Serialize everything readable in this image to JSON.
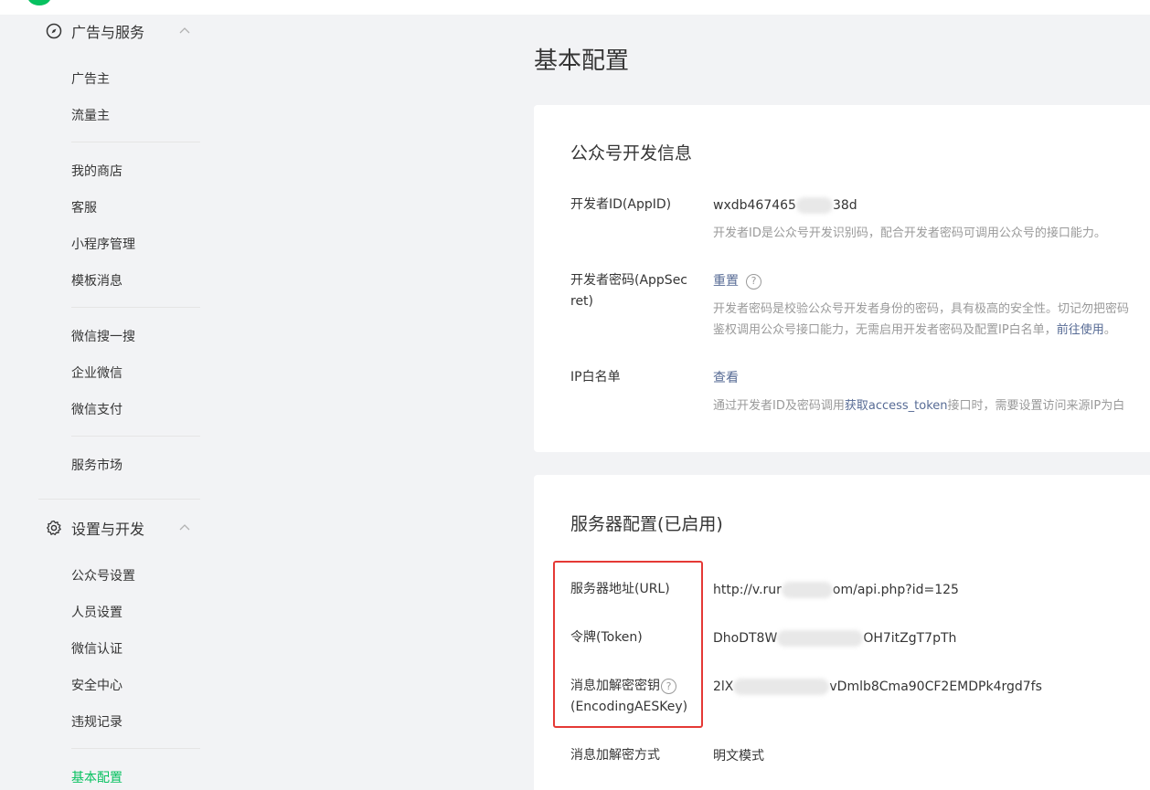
{
  "sidebar": {
    "ads_section": {
      "title": "广告与服务",
      "icon": "compass-icon"
    },
    "ads_items": [
      "广告主",
      "流量主"
    ],
    "group2": [
      "我的商店",
      "客服",
      "小程序管理",
      "模板消息"
    ],
    "group3": [
      "微信搜一搜",
      "企业微信",
      "微信支付"
    ],
    "group4": [
      "服务市场"
    ],
    "settings_section": {
      "title": "设置与开发",
      "icon": "gear-icon"
    },
    "settings_items": [
      "公众号设置",
      "人员设置",
      "微信认证",
      "安全中心",
      "违规记录"
    ],
    "active_item": "基本配置"
  },
  "main": {
    "page_title": "基本配置",
    "dev_info": {
      "title": "公众号开发信息",
      "appid_label": "开发者ID(AppID)",
      "appid_value_a": "wxdb467465",
      "appid_value_b": "38d",
      "appid_desc": "开发者ID是公众号开发识别码，配合开发者密码可调用公众号的接口能力。",
      "secret_label_1": "开发者密码(AppSec",
      "secret_label_2": "ret)",
      "secret_action": "重置",
      "secret_desc_1": "开发者密码是校验公众号开发者身份的密码，具有极高的安全性。切记勿把密码",
      "secret_desc_2a": "鉴权调用公众号接口能力，无需启用开发者密码及配置IP白名单，",
      "secret_desc_2_link": "前往使用",
      "secret_desc_2b": "。",
      "ip_label": "IP白名单",
      "ip_action": "查看",
      "ip_desc_a": "通过开发者ID及密码调用",
      "ip_desc_link": "获取access_token",
      "ip_desc_b": "接口时，需要设置访问来源IP为白"
    },
    "server": {
      "title": "服务器配置(已启用)",
      "url_label": "服务器地址(URL)",
      "url_value_a": "http://v.rur",
      "url_value_b": "om/api.php?id=125",
      "token_label": "令牌(Token)",
      "token_value_a": "DhoDT8W",
      "token_value_b": "OH7itZgT7pTh",
      "aes_label_1": "消息加解密密钥",
      "aes_label_2": "(EncodingAESKey)",
      "aes_value_a": "2lX",
      "aes_value_b": "vDmlb8Cma90CF2EMDPk4rgd7fs",
      "mode_label": "消息加解密方式",
      "mode_value": "明文模式"
    },
    "help_glyph": "?"
  },
  "colors": {
    "accent": "#07c160",
    "link": "#576b95",
    "highlight_box": "#e53935"
  }
}
